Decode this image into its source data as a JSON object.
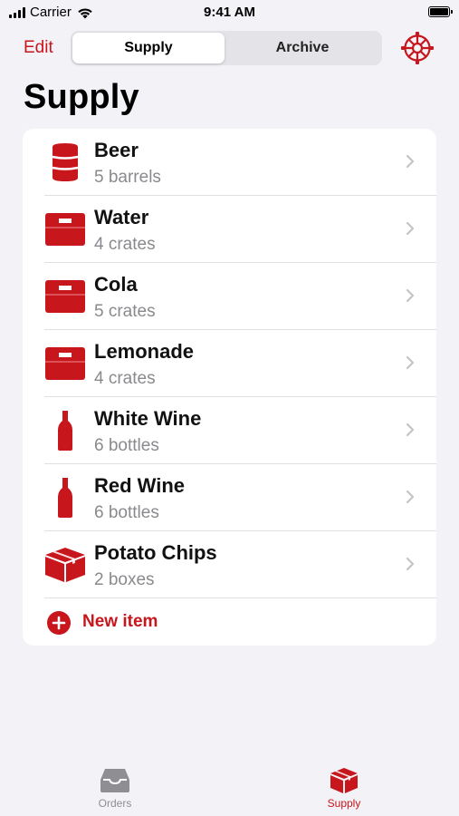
{
  "status_bar": {
    "carrier": "Carrier",
    "time": "9:41 AM"
  },
  "nav": {
    "edit_label": "Edit",
    "segments": [
      "Supply",
      "Archive"
    ],
    "selected_segment": "Supply",
    "settings_icon": "gear-icon"
  },
  "title": "Supply",
  "items": [
    {
      "name": "Beer",
      "quantity": "5 barrels",
      "icon": "barrel-icon"
    },
    {
      "name": "Water",
      "quantity": "4 crates",
      "icon": "crate-icon"
    },
    {
      "name": "Cola",
      "quantity": "5 crates",
      "icon": "crate-icon"
    },
    {
      "name": "Lemonade",
      "quantity": "4 crates",
      "icon": "crate-icon"
    },
    {
      "name": "White Wine",
      "quantity": "6 bottles",
      "icon": "bottle-icon"
    },
    {
      "name": "Red Wine",
      "quantity": "6 bottles",
      "icon": "bottle-icon"
    },
    {
      "name": "Potato Chips",
      "quantity": "2 boxes",
      "icon": "box-icon"
    }
  ],
  "new_item_label": "New item",
  "tabs": [
    {
      "label": "Orders",
      "icon": "tray-icon",
      "selected": false
    },
    {
      "label": "Supply",
      "icon": "box-icon",
      "selected": true
    }
  ],
  "colors": {
    "accent": "#c8161d",
    "background": "#f2f2f7",
    "secondary_text": "#8a8a8e"
  }
}
